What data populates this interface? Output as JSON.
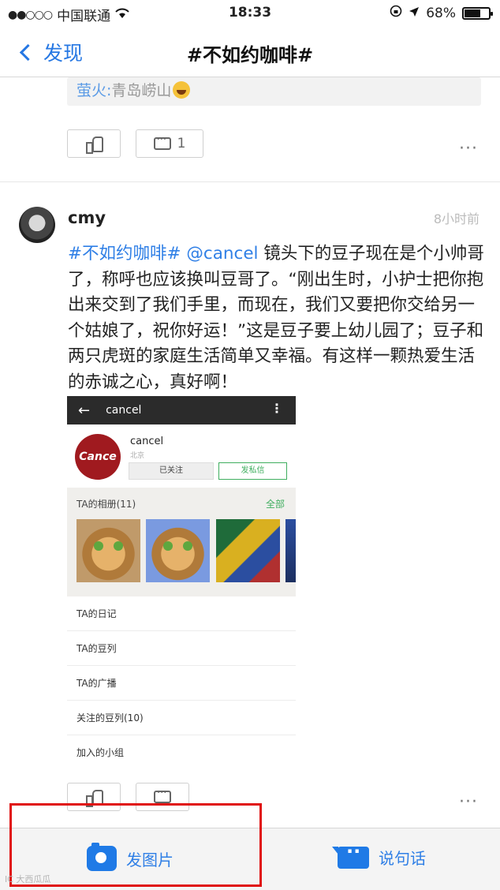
{
  "status_bar": {
    "signal": "●●○○○",
    "carrier": "中国联通",
    "time": "18:33",
    "battery_level": "68%",
    "battery_fraction": 0.68
  },
  "nav": {
    "back_label": "发现",
    "title": "#不如约咖啡#"
  },
  "prev_post": {
    "reply": {
      "user": "萤火:",
      "text": "青岛崂山"
    },
    "like_label": "",
    "comment_count": "1",
    "more_label": "···"
  },
  "post": {
    "username": "cmy",
    "time_ago": "8小时前",
    "tag": "#不如约咖啡#",
    "mention": "@cancel",
    "text": "镜头下的豆子现在是个小帅哥了，称呼也应该换叫豆哥了。“刚出生时，小护士把你抱出来交到了我们手里，而现在，我们又要把你交给另一个姑娘了，祝你好运！”这是豆子要上幼儿园了；豆子和两只虎斑的家庭生活简单又幸福。有这样一颗热爱生活的赤诚之心，真好啊！",
    "more_label": "···",
    "embed": {
      "bar_title": "cancel",
      "arrow": "←",
      "kebab": "⋮",
      "avatar_text": "Cance",
      "name": "cancel",
      "city": "北京",
      "follow_label": "已关注",
      "message_label": "发私信",
      "album_title": "TA的相册(11)",
      "album_all": "全部",
      "rows": [
        "TA的日记",
        "TA的豆列",
        "TA的广播",
        "关注的豆列(10)",
        "加入的小组"
      ]
    }
  },
  "toolbar": {
    "photo_label": "发图片",
    "say_label": "说句话"
  },
  "watermark": "IC 大西瓜瓜"
}
